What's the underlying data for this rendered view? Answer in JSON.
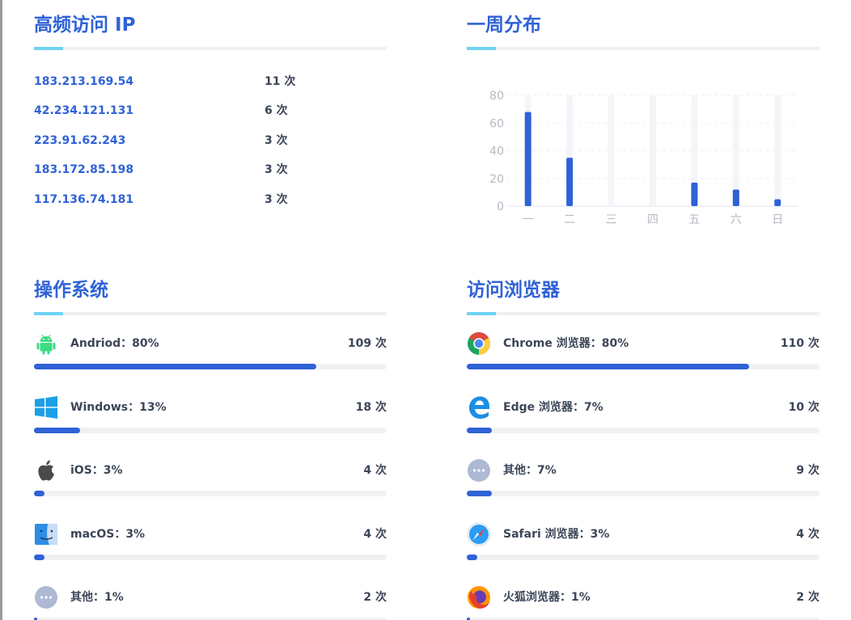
{
  "ip_panel": {
    "title": "高频访问 IP",
    "rows": [
      {
        "ip": "183.213.169.54",
        "count": "11 次"
      },
      {
        "ip": "42.234.121.131",
        "count": "6 次"
      },
      {
        "ip": "223.91.62.243",
        "count": "3 次"
      },
      {
        "ip": "183.172.85.198",
        "count": "3 次"
      },
      {
        "ip": "117.136.74.181",
        "count": "3 次"
      }
    ]
  },
  "week_panel": {
    "title": "一周分布"
  },
  "chart_data": {
    "type": "bar",
    "categories": [
      "一",
      "二",
      "三",
      "四",
      "五",
      "六",
      "日"
    ],
    "values": [
      68,
      35,
      0,
      0,
      17,
      12,
      5
    ],
    "title": "",
    "xlabel": "",
    "ylabel": "",
    "ylim": [
      0,
      80
    ],
    "yticks": [
      0,
      20,
      40,
      60,
      80
    ],
    "grid": true,
    "bar_color": "#2f62d6",
    "bar_background_color": "#f3f5f9"
  },
  "os_panel": {
    "title": "操作系统",
    "items": [
      {
        "icon": "android-icon",
        "label": "Andriod：80%",
        "count": "109 次",
        "percent": 80
      },
      {
        "icon": "windows-icon",
        "label": "Windows：13%",
        "count": "18 次",
        "percent": 13
      },
      {
        "icon": "apple-icon",
        "label": "iOS：3%",
        "count": "4 次",
        "percent": 3
      },
      {
        "icon": "macos-finder-icon",
        "label": "macOS：3%",
        "count": "4 次",
        "percent": 3
      },
      {
        "icon": "more-icon",
        "label": "其他：1%",
        "count": "2 次",
        "percent": 1
      }
    ]
  },
  "browser_panel": {
    "title": "访问浏览器",
    "items": [
      {
        "icon": "chrome-icon",
        "label": "Chrome 浏览器：80%",
        "count": "110 次",
        "percent": 80
      },
      {
        "icon": "edge-icon",
        "label": "Edge 浏览器：7%",
        "count": "10 次",
        "percent": 7
      },
      {
        "icon": "more-icon",
        "label": "其他：7%",
        "count": "9 次",
        "percent": 7
      },
      {
        "icon": "safari-icon",
        "label": "Safari 浏览器：3%",
        "count": "4 次",
        "percent": 3
      },
      {
        "icon": "firefox-icon",
        "label": "火狐浏览器：1%",
        "count": "2 次",
        "percent": 1
      }
    ]
  },
  "colors": {
    "accent": "#2f62d6",
    "title_underline": "#6fd3f1",
    "track": "#f0f1f3",
    "text_dark": "#3c4658"
  }
}
